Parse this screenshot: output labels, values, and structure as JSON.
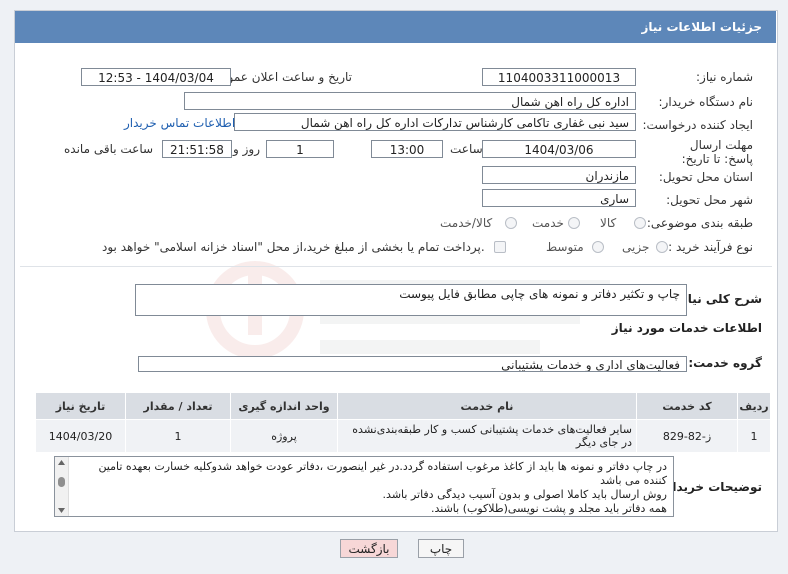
{
  "header": {
    "title": "جزئیات اطلاعات نیاز"
  },
  "fields": {
    "need_number_label": "شماره نیاز:",
    "need_number": "1104003311000013",
    "announce_label": "تاریخ و ساعت اعلان عمومی:",
    "announce_value": "1404/03/04 - 12:53",
    "buyer_org_label": "نام دستگاه خریدار:",
    "buyer_org": "اداره کل راه اهن شمال",
    "creator_label": "ایجاد کننده درخواست:",
    "creator": "سید نبی غفاری تاکامی کارشناس تدارکات اداره کل راه اهن شمال",
    "buyer_contact_link": "اطلاعات تماس خریدار",
    "deadline_label": "مهلت ارسال پاسخ: تا تاریخ:",
    "deadline_date": "1404/03/06",
    "hour_label": "ساعت",
    "deadline_time": "13:00",
    "days_value": "1",
    "days_label": "روز و",
    "remaining_time": "21:51:58",
    "remaining_label": "ساعت باقی مانده",
    "province_label": "استان محل تحویل:",
    "province": "مازندران",
    "city_label": "شهر محل تحویل:",
    "city": "ساری",
    "category_label": "طبقه بندی موضوعی:",
    "category_options": [
      "کالا",
      "خدمت",
      "کالا/خدمت"
    ],
    "purchase_label": "نوع فرآیند خرید :",
    "purchase_options": [
      "جزیی",
      "متوسط"
    ],
    "payment_note": "پرداخت تمام یا بخشی از مبلغ خرید،از محل \"اسناد خزانه اسلامی\" خواهد بود."
  },
  "summary": {
    "label": "شرح کلی نیاز:",
    "value": "چاپ و تکثیر دفاتر و نمونه های چاپی مطابق فایل پیوست"
  },
  "services": {
    "section_title": "اطلاعات خدمات مورد نیاز",
    "group_label": "گروه خدمت:",
    "group_value": "فعالیت‌های اداری و خدمات پشتیبانی",
    "table": {
      "headers": [
        "ردیف",
        "کد خدمت",
        "نام خدمت",
        "واحد اندازه گیری",
        "تعداد / مقدار",
        "تاریخ نیاز"
      ],
      "rows": [
        [
          "1",
          "ز-82-829",
          "سایر فعالیت‌های خدمات پشتیبانی کسب و کار طبقه‌بندی‌نشده در جای دیگر",
          "پروژه",
          "1",
          "1404/03/20"
        ]
      ]
    }
  },
  "buyer_notes": {
    "label": "توضیحات خریدار:",
    "lines": [
      "در چاپ دفاتر و نمونه ها باید از کاغذ مرغوب استفاده گردد.در غیر اینصورت ،دفاتر عودت خواهد شدوکلیه خسارت بعهده تامین کننده می باشد",
      "روش ارسال باید کاملا اصولی و بدون آسیب دیدگی دفاتر باشد.",
      "همه دفاتر باید مجلد و پشت نویسی(طلاکوب) باشند."
    ]
  },
  "buttons": {
    "print": "چاپ",
    "back": "بازگشت"
  },
  "colors": {
    "title_bg": "#5d87b9",
    "back_btn_bg": "#f7d7d7",
    "link": "#1f5fb0"
  }
}
